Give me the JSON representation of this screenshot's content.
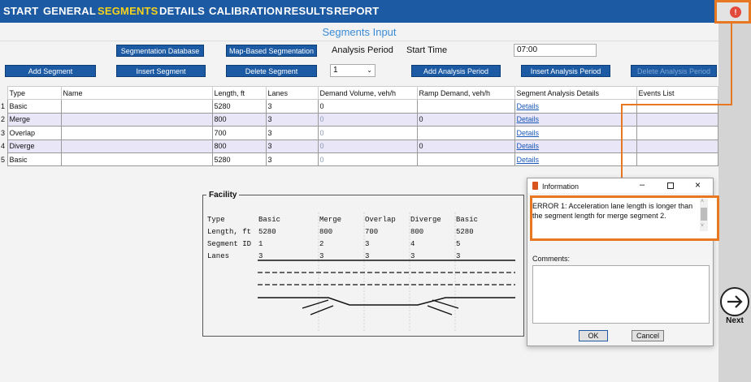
{
  "nav": {
    "items": [
      "START",
      "GENERAL",
      "SEGMENTS",
      "DETAILS",
      "CALIBRATION",
      "RESULTS",
      "REPORT"
    ],
    "active": "SEGMENTS"
  },
  "alert_badge": "!",
  "title": "Segments Input",
  "buttons": {
    "segmentation_database": "Segmentation Database",
    "map_based_segmentation": "Map-Based Segmentation",
    "add_segment": "Add Segment",
    "insert_segment": "Insert Segment",
    "delete_segment": "Delete Segment",
    "add_analysis_period": "Add Analysis Period",
    "insert_analysis_period": "Insert Analysis Period",
    "delete_analysis_period": "Delete Analysis Period"
  },
  "analysis_period": {
    "label": "Analysis Period",
    "value": "1"
  },
  "start_time": {
    "label": "Start Time",
    "value": "07:00"
  },
  "table": {
    "headers": [
      "Type",
      "Name",
      "Length, ft",
      "Lanes",
      "Demand Volume, veh/h",
      "Ramp Demand, veh/h",
      "Segment Analysis Details",
      "Events List"
    ],
    "rows": [
      {
        "num": "1",
        "type": "Basic",
        "name": "",
        "length": "5280",
        "lanes": "3",
        "demand": "0",
        "ramp": "",
        "details": "Details",
        "events": ""
      },
      {
        "num": "2",
        "type": "Merge",
        "name": "",
        "length": "800",
        "lanes": "3",
        "demand": "0",
        "ramp": "0",
        "details": "Details",
        "events": ""
      },
      {
        "num": "3",
        "type": "Overlap",
        "name": "",
        "length": "700",
        "lanes": "3",
        "demand": "0",
        "ramp": "",
        "details": "Details",
        "events": ""
      },
      {
        "num": "4",
        "type": "Diverge",
        "name": "",
        "length": "800",
        "lanes": "3",
        "demand": "0",
        "ramp": "0",
        "details": "Details",
        "events": ""
      },
      {
        "num": "5",
        "type": "Basic",
        "name": "",
        "length": "5280",
        "lanes": "3",
        "demand": "0",
        "ramp": "",
        "details": "Details",
        "events": ""
      }
    ]
  },
  "facility": {
    "title": "Facility",
    "row_labels": [
      "Type",
      "Length, ft",
      "Segment ID",
      "Lanes"
    ],
    "columns": [
      {
        "type": "Basic",
        "length": "5280",
        "id": "1",
        "lanes": "3"
      },
      {
        "type": "Merge",
        "length": "800",
        "id": "2",
        "lanes": "3"
      },
      {
        "type": "Overlap",
        "length": "700",
        "id": "3",
        "lanes": "3"
      },
      {
        "type": "Diverge",
        "length": "800",
        "id": "4",
        "lanes": "3"
      },
      {
        "type": "Basic",
        "length": "5280",
        "id": "5",
        "lanes": "3"
      }
    ]
  },
  "dialog": {
    "title": "Information",
    "error_text": "ERROR 1: Acceleration lane length is longer than the segment length for merge segment 2.",
    "comments_label": "Comments:",
    "ok": "OK",
    "cancel": "Cancel"
  },
  "next_label": "Next",
  "colors": {
    "nav_bg": "#1c5aa3",
    "active_nav": "#f5d21c",
    "highlight": "#e87722",
    "alt_row": "#e9e6f7"
  }
}
